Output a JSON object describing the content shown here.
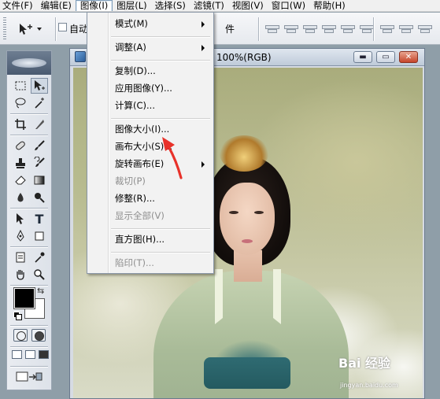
{
  "menubar": {
    "items": [
      "文件(F)",
      "编辑(E)",
      "图像(I)",
      "图层(L)",
      "选择(S)",
      "滤镜(T)",
      "视图(V)",
      "窗口(W)",
      "帮助(H)"
    ],
    "active": "图像(I)"
  },
  "options_bar": {
    "auto_select_label": "自动",
    "transform_label": "件"
  },
  "document": {
    "title": "100%(RGB)",
    "buttons": {
      "minimize": "▬",
      "restore": "▭",
      "close": "✕"
    }
  },
  "image_menu": {
    "items": [
      {
        "label": "模式(M)",
        "submenu": true,
        "enabled": true
      },
      {
        "label": "调整(A)",
        "submenu": true,
        "enabled": true
      },
      {
        "label": "复制(D)...",
        "submenu": false,
        "enabled": true
      },
      {
        "label": "应用图像(Y)...",
        "submenu": false,
        "enabled": true
      },
      {
        "label": "计算(C)...",
        "submenu": false,
        "enabled": true
      },
      {
        "label": "图像大小(I)...",
        "submenu": false,
        "enabled": true
      },
      {
        "label": "画布大小(S)...",
        "submenu": false,
        "enabled": true
      },
      {
        "label": "旋转画布(E)",
        "submenu": true,
        "enabled": true
      },
      {
        "label": "裁切(P)",
        "submenu": false,
        "enabled": false
      },
      {
        "label": "修整(R)...",
        "submenu": false,
        "enabled": true
      },
      {
        "label": "显示全部(V)",
        "submenu": false,
        "enabled": false
      },
      {
        "label": "直方图(H)...",
        "submenu": false,
        "enabled": true
      },
      {
        "label": "陷印(T)...",
        "submenu": false,
        "enabled": false
      }
    ]
  },
  "colors": {
    "foreground": "#000000",
    "background": "#ffffff",
    "annotation_arrow": "#e8322a"
  },
  "toolbox": {
    "tools": [
      "marquee-tool",
      "move-tool",
      "lasso-tool",
      "magic-wand-tool",
      "crop-tool",
      "slice-tool",
      "healing-brush-tool",
      "brush-tool",
      "clone-stamp-tool",
      "history-brush-tool",
      "eraser-tool",
      "gradient-tool",
      "blur-tool",
      "dodge-tool",
      "path-selection-tool",
      "type-tool",
      "pen-tool",
      "shape-tool",
      "notes-tool",
      "eyedropper-tool",
      "hand-tool",
      "zoom-tool"
    ],
    "type_tool_glyph": "T"
  },
  "watermark": {
    "text": "Bai 经验",
    "sub": "jingyan.baidu.com"
  }
}
